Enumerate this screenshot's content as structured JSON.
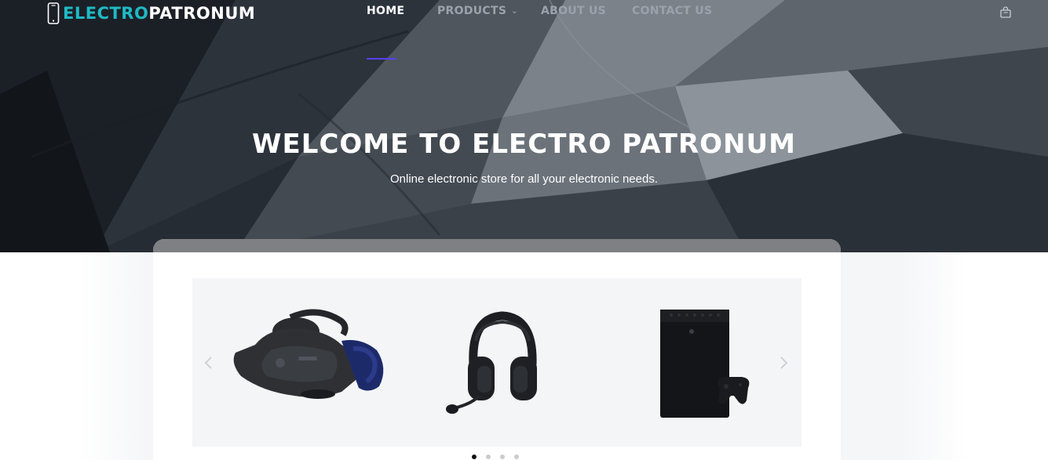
{
  "brand": {
    "part1": "ELECTRO",
    "part2": " PATRONUM",
    "icon": "smartphone-icon",
    "accent_color": "#1fb9c4"
  },
  "nav": {
    "items": [
      {
        "label": "HOME",
        "active": true
      },
      {
        "label": "PRODUCTS",
        "has_dropdown": true
      },
      {
        "label": "ABOUT US"
      },
      {
        "label": "CONTACT US"
      }
    ],
    "active_underline_color": "#5b3ff3",
    "cart_icon": "shopping-bag-icon"
  },
  "hero": {
    "title": "WELCOME TO ELECTRO PATRONUM",
    "subtitle": "Online electronic store for all your electronic needs."
  },
  "carousel": {
    "slides": [
      {
        "product": "vr-headset",
        "icon": "vr-headset-image"
      },
      {
        "product": "gaming-headset",
        "icon": "headset-image"
      },
      {
        "product": "game-console",
        "icon": "console-image"
      }
    ],
    "dots": 4,
    "active_dot": 1,
    "prev_icon": "chevron-left-icon",
    "next_icon": "chevron-right-icon"
  }
}
